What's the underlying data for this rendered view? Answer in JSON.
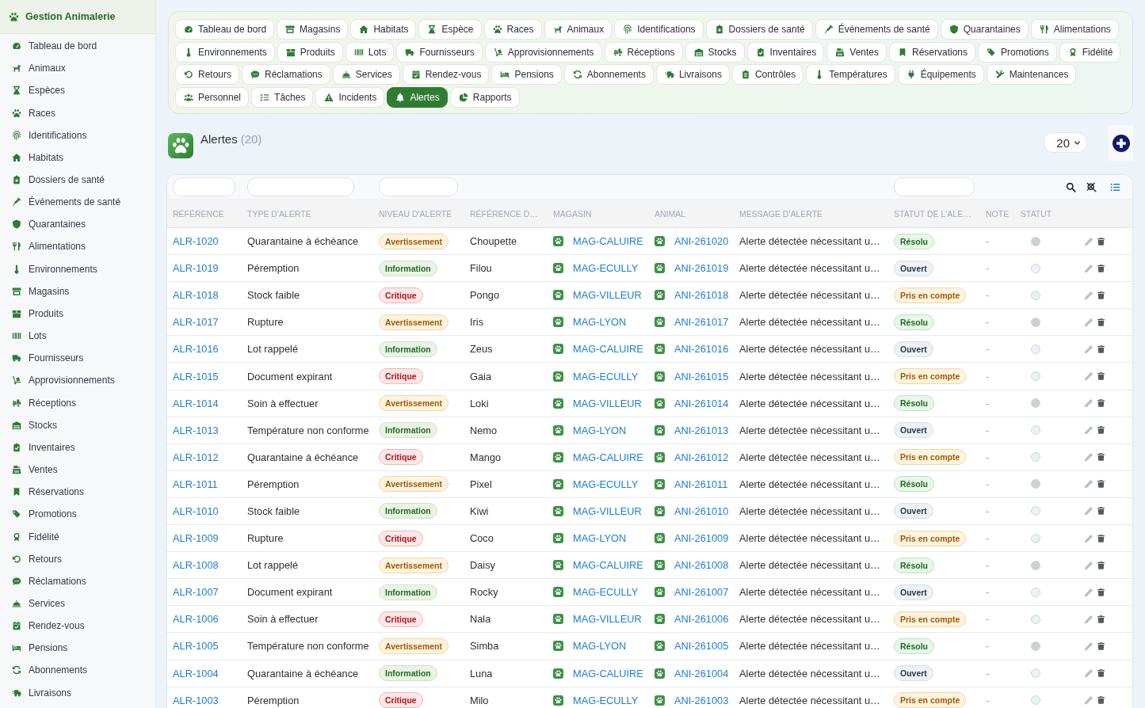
{
  "sidebar": {
    "title": "Gestion Animalerie",
    "items": [
      "Tableau de bord",
      "Animaux",
      "Espèces",
      "Races",
      "Identifications",
      "Habitats",
      "Dossiers de santé",
      "Événements de santé",
      "Quarantaines",
      "Alimentations",
      "Environnements",
      "Magasins",
      "Produits",
      "Lots",
      "Fournisseurs",
      "Approvisionnements",
      "Réceptions",
      "Stocks",
      "Inventaires",
      "Ventes",
      "Réservations",
      "Promotions",
      "Fidélité",
      "Retours",
      "Réclamations",
      "Services",
      "Rendez-vous",
      "Pensions",
      "Abonnements",
      "Livraisons"
    ]
  },
  "nav": {
    "tab_rows": [
      [
        {
          "label": "Tableau de bord",
          "selected": false
        },
        {
          "label": "Magasins",
          "selected": false
        },
        {
          "label": "Habitats",
          "selected": false
        },
        {
          "label": "Espèce",
          "selected": false
        },
        {
          "label": "Races",
          "selected": false
        },
        {
          "label": "Animaux",
          "selected": false
        },
        {
          "label": "Identifications",
          "selected": false
        },
        {
          "label": "Dossiers de santé",
          "selected": false
        },
        {
          "label": "Événements de santé",
          "selected": false
        },
        {
          "label": "Quarantaines",
          "selected": false
        },
        {
          "label": "Alimentations",
          "selected": false
        }
      ],
      [
        {
          "label": "Environnements",
          "selected": false
        },
        {
          "label": "Produits",
          "selected": false
        },
        {
          "label": "Lots",
          "selected": false
        },
        {
          "label": "Fournisseurs",
          "selected": false
        },
        {
          "label": "Approvisionnements",
          "selected": false
        },
        {
          "label": "Réceptions",
          "selected": false
        },
        {
          "label": "Stocks",
          "selected": false
        },
        {
          "label": "Inventaires",
          "selected": false
        },
        {
          "label": "Ventes",
          "selected": false
        },
        {
          "label": "Réservations",
          "selected": false
        },
        {
          "label": "Promotions",
          "selected": false
        },
        {
          "label": "Fidélité",
          "selected": false
        }
      ],
      [
        {
          "label": "Retours",
          "selected": false
        },
        {
          "label": "Réclamations",
          "selected": false
        },
        {
          "label": "Services",
          "selected": false
        },
        {
          "label": "Rendez-vous",
          "selected": false
        },
        {
          "label": "Pensions",
          "selected": false
        },
        {
          "label": "Abonnements",
          "selected": false
        },
        {
          "label": "Livraisons",
          "selected": false
        },
        {
          "label": "Contrôles",
          "selected": false
        },
        {
          "label": "Températures",
          "selected": false
        },
        {
          "label": "Équipements",
          "selected": false
        },
        {
          "label": "Maintenances",
          "selected": false
        }
      ],
      [
        {
          "label": "Personnel",
          "selected": false
        },
        {
          "label": "Tâches",
          "selected": false
        },
        {
          "label": "Incidents",
          "selected": false
        },
        {
          "label": "Alertes",
          "selected": true
        },
        {
          "label": "Rapports",
          "selected": false
        }
      ]
    ]
  },
  "header": {
    "title": "Alertes",
    "count": "(20)",
    "page_size": "20"
  },
  "table": {
    "columns": [
      {
        "label": "RÉFÉRENCE",
        "filter": true
      },
      {
        "label": "TYPE D'ALERTE",
        "filter": true
      },
      {
        "label": "NIVEAU D'ALERTE",
        "filter": true
      },
      {
        "label": "RÉFÉRENCE D…",
        "filter": false
      },
      {
        "label": "MAGASIN",
        "filter": false
      },
      {
        "label": "ANIMAL",
        "filter": false
      },
      {
        "label": "MESSAGE D'ALERTE",
        "filter": false
      },
      {
        "label": "STATUT DE L'ALE…",
        "filter": true
      },
      {
        "label": "NOTE",
        "filter": false
      },
      {
        "label": "STATUT",
        "filter": false
      }
    ],
    "rows": [
      {
        "reference": "ALR-1020",
        "alert_type": "Quarantaine à échéance",
        "alert_level": {
          "label": "Avertissement",
          "kind": "warning"
        },
        "column_4": "Choupette",
        "store": "MAG-CALUIRE",
        "animal": "ANI-261020",
        "message": "Alerte détectée nécessitant u…",
        "column_8": {
          "label": "Résolu",
          "kind": "resolved"
        },
        "note": "-",
        "status": {
          "color": "#c9d1d1"
        }
      },
      {
        "reference": "ALR-1019",
        "alert_type": "Péremption",
        "alert_level": {
          "label": "Information",
          "kind": "info"
        },
        "column_4": "Filou",
        "store": "MAG-ECULLY",
        "animal": "ANI-261019",
        "message": "Alerte détectée nécessitant u…",
        "column_8": {
          "label": "Ouvert",
          "kind": "open"
        },
        "note": "-",
        "status": {
          "color": "#eef2f6"
        }
      },
      {
        "reference": "ALR-1018",
        "alert_type": "Stock faible",
        "alert_level": {
          "label": "Critique",
          "kind": "critical"
        },
        "column_4": "Pongo",
        "store": "MAG-VILLEUR",
        "animal": "ANI-261018",
        "message": "Alerte détectée nécessitant u…",
        "column_8": {
          "label": "Pris en compte",
          "kind": "acknowledged"
        },
        "note": "-",
        "status": {
          "color": "#e2f6eb"
        }
      },
      {
        "reference": "ALR-1017",
        "alert_type": "Rupture",
        "alert_level": {
          "label": "Avertissement",
          "kind": "warning"
        },
        "column_4": "Iris",
        "store": "MAG-LYON",
        "animal": "ANI-261017",
        "message": "Alerte détectée nécessitant u…",
        "column_8": {
          "label": "Résolu",
          "kind": "resolved"
        },
        "note": "-",
        "status": {
          "color": "#c9d1d1"
        }
      },
      {
        "reference": "ALR-1016",
        "alert_type": "Lot rappelé",
        "alert_level": {
          "label": "Information",
          "kind": "info"
        },
        "column_4": "Zeus",
        "store": "MAG-CALUIRE",
        "animal": "ANI-261016",
        "message": "Alerte détectée nécessitant u…",
        "column_8": {
          "label": "Ouvert",
          "kind": "open"
        },
        "note": "-",
        "status": {
          "color": "#eef2f6"
        }
      },
      {
        "reference": "ALR-1015",
        "alert_type": "Document expirant",
        "alert_level": {
          "label": "Critique",
          "kind": "critical"
        },
        "column_4": "Gaia",
        "store": "MAG-ECULLY",
        "animal": "ANI-261015",
        "message": "Alerte détectée nécessitant u…",
        "column_8": {
          "label": "Pris en compte",
          "kind": "acknowledged"
        },
        "note": "-",
        "status": {
          "color": "#e2f6eb"
        }
      },
      {
        "reference": "ALR-1014",
        "alert_type": "Soin à effectuer",
        "alert_level": {
          "label": "Avertissement",
          "kind": "warning"
        },
        "column_4": "Loki",
        "store": "MAG-VILLEUR",
        "animal": "ANI-261014",
        "message": "Alerte détectée nécessitant u…",
        "column_8": {
          "label": "Résolu",
          "kind": "resolved"
        },
        "note": "-",
        "status": {
          "color": "#c9d1d1"
        }
      },
      {
        "reference": "ALR-1013",
        "alert_type": "Température non conforme",
        "alert_level": {
          "label": "Information",
          "kind": "info"
        },
        "column_4": "Nemo",
        "store": "MAG-LYON",
        "animal": "ANI-261013",
        "message": "Alerte détectée nécessitant u…",
        "column_8": {
          "label": "Ouvert",
          "kind": "open"
        },
        "note": "-",
        "status": {
          "color": "#eef2f6"
        }
      },
      {
        "reference": "ALR-1012",
        "alert_type": "Quarantaine à échéance",
        "alert_level": {
          "label": "Critique",
          "kind": "critical"
        },
        "column_4": "Mango",
        "store": "MAG-CALUIRE",
        "animal": "ANI-261012",
        "message": "Alerte détectée nécessitant u…",
        "column_8": {
          "label": "Pris en compte",
          "kind": "acknowledged"
        },
        "note": "-",
        "status": {
          "color": "#e2f6eb"
        }
      },
      {
        "reference": "ALR-1011",
        "alert_type": "Péremption",
        "alert_level": {
          "label": "Avertissement",
          "kind": "warning"
        },
        "column_4": "Pixel",
        "store": "MAG-ECULLY",
        "animal": "ANI-261011",
        "message": "Alerte détectée nécessitant u…",
        "column_8": {
          "label": "Résolu",
          "kind": "resolved"
        },
        "note": "-",
        "status": {
          "color": "#c9d1d1"
        }
      },
      {
        "reference": "ALR-1010",
        "alert_type": "Stock faible",
        "alert_level": {
          "label": "Information",
          "kind": "info"
        },
        "column_4": "Kiwi",
        "store": "MAG-VILLEUR",
        "animal": "ANI-261010",
        "message": "Alerte détectée nécessitant u…",
        "column_8": {
          "label": "Ouvert",
          "kind": "open"
        },
        "note": "-",
        "status": {
          "color": "#eef2f6"
        }
      },
      {
        "reference": "ALR-1009",
        "alert_type": "Rupture",
        "alert_level": {
          "label": "Critique",
          "kind": "critical"
        },
        "column_4": "Coco",
        "store": "MAG-LYON",
        "animal": "ANI-261009",
        "message": "Alerte détectée nécessitant u…",
        "column_8": {
          "label": "Pris en compte",
          "kind": "acknowledged"
        },
        "note": "-",
        "status": {
          "color": "#e2f6eb"
        }
      },
      {
        "reference": "ALR-1008",
        "alert_type": "Lot rappelé",
        "alert_level": {
          "label": "Avertissement",
          "kind": "warning"
        },
        "column_4": "Daisy",
        "store": "MAG-CALUIRE",
        "animal": "ANI-261008",
        "message": "Alerte détectée nécessitant u…",
        "column_8": {
          "label": "Résolu",
          "kind": "resolved"
        },
        "note": "-",
        "status": {
          "color": "#c9d1d1"
        }
      },
      {
        "reference": "ALR-1007",
        "alert_type": "Document expirant",
        "alert_level": {
          "label": "Information",
          "kind": "info"
        },
        "column_4": "Rocky",
        "store": "MAG-ECULLY",
        "animal": "ANI-261007",
        "message": "Alerte détectée nécessitant u…",
        "column_8": {
          "label": "Ouvert",
          "kind": "open"
        },
        "note": "-",
        "status": {
          "color": "#eef2f6"
        }
      },
      {
        "reference": "ALR-1006",
        "alert_type": "Soin à effectuer",
        "alert_level": {
          "label": "Critique",
          "kind": "critical"
        },
        "column_4": "Nala",
        "store": "MAG-VILLEUR",
        "animal": "ANI-261006",
        "message": "Alerte détectée nécessitant u…",
        "column_8": {
          "label": "Pris en compte",
          "kind": "acknowledged"
        },
        "note": "-",
        "status": {
          "color": "#e2f6eb"
        }
      },
      {
        "reference": "ALR-1005",
        "alert_type": "Température non conforme",
        "alert_level": {
          "label": "Avertissement",
          "kind": "warning"
        },
        "column_4": "Simba",
        "store": "MAG-LYON",
        "animal": "ANI-261005",
        "message": "Alerte détectée nécessitant u…",
        "column_8": {
          "label": "Résolu",
          "kind": "resolved"
        },
        "note": "-",
        "status": {
          "color": "#c9d1d1"
        }
      },
      {
        "reference": "ALR-1004",
        "alert_type": "Quarantaine à échéance",
        "alert_level": {
          "label": "Information",
          "kind": "info"
        },
        "column_4": "Luna",
        "store": "MAG-CALUIRE",
        "animal": "ANI-261004",
        "message": "Alerte détectée nécessitant u…",
        "column_8": {
          "label": "Ouvert",
          "kind": "open"
        },
        "note": "-",
        "status": {
          "color": "#eef2f6"
        }
      },
      {
        "reference": "ALR-1003",
        "alert_type": "Péremption",
        "alert_level": {
          "label": "Critique",
          "kind": "critical"
        },
        "column_4": "Milo",
        "store": "MAG-ECULLY",
        "animal": "ANI-261003",
        "message": "Alerte détectée nécessitant u…",
        "column_8": {
          "label": "Pris en compte",
          "kind": "acknowledged"
        },
        "note": "-",
        "status": {
          "color": "#e2f6eb"
        }
      }
    ]
  }
}
